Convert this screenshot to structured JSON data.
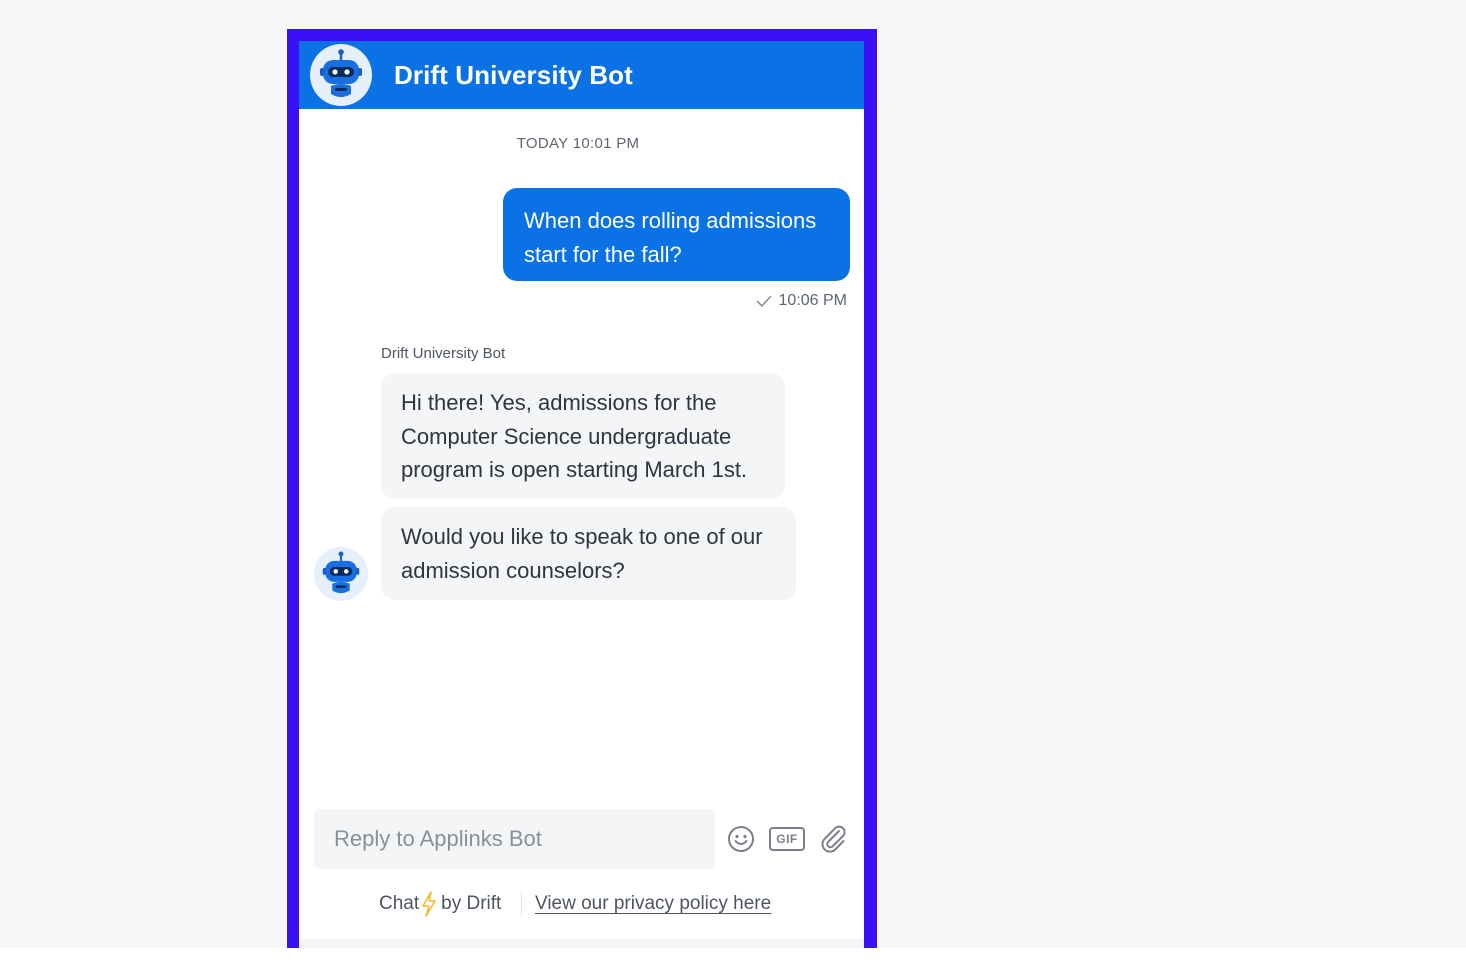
{
  "header": {
    "title": "Drift University Bot",
    "avatar_icon": "robot-icon"
  },
  "conversation": {
    "day_stamp": "TODAY 10:01 PM",
    "user_message": "When does rolling admissions start for the fall?",
    "user_message_time": "10:06 PM",
    "read_icon": "checkmark-icon",
    "bot_sender": "Drift University Bot",
    "bot_messages": [
      "Hi there! Yes, admissions for the Computer Science undergraduate program is open starting March 1st.",
      "Would you like to speak to one of our admission counselors?"
    ]
  },
  "composer": {
    "placeholder": "Reply to Applinks Bot",
    "value": "",
    "emoji_icon": "smiley-icon",
    "gif_label": "GIF",
    "attach_icon": "paperclip-icon"
  },
  "footer": {
    "chat_label": "Chat",
    "bolt_icon": "lightning-bolt-icon",
    "by_label": "by Drift",
    "privacy_link": "View our privacy policy here"
  },
  "colors": {
    "frame": "#3a10f5",
    "brand_blue": "#0b72e6",
    "bubble_gray": "#f4f5f7",
    "bolt": "#f5b82e"
  }
}
